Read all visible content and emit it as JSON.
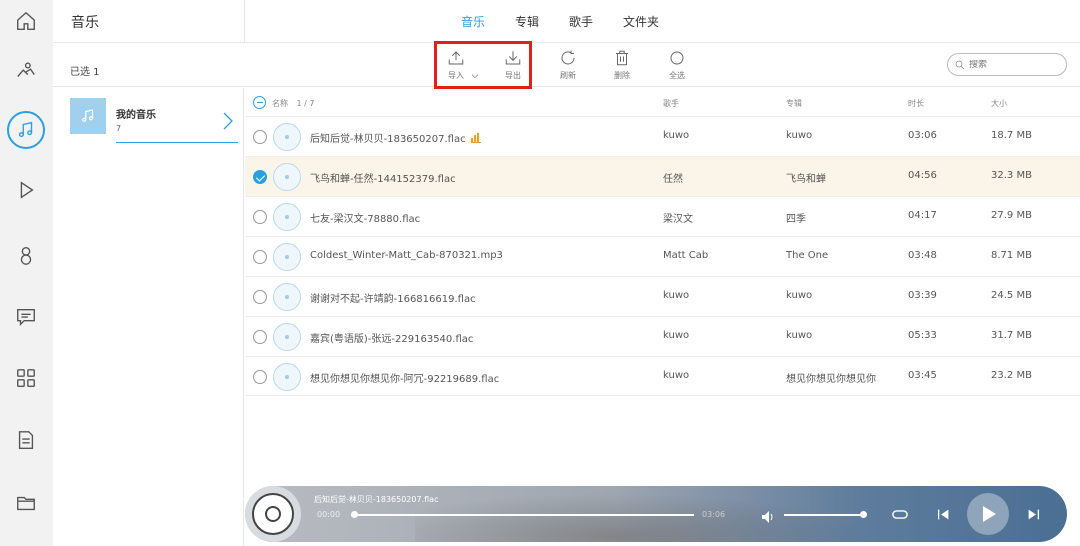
{
  "header": {
    "title": "音乐",
    "tabs": [
      {
        "label": "音乐",
        "active": true
      },
      {
        "label": "专辑",
        "active": false
      },
      {
        "label": "歌手",
        "active": false
      },
      {
        "label": "文件夹",
        "active": false
      }
    ]
  },
  "rail": {
    "items": [
      "home-icon",
      "people-icon",
      "music-note-icon",
      "play-icon",
      "user-icon",
      "message-icon",
      "apps-icon",
      "document-icon",
      "folder-icon"
    ],
    "active": "music-note-icon"
  },
  "toolbar": {
    "selected_text": "已选 1",
    "import_label": "导入",
    "export_label": "导出",
    "refresh_label": "刷新",
    "delete_label": "删除",
    "select_all_label": "全选",
    "search_placeholder": "搜索"
  },
  "playlist": {
    "name": "我的音乐",
    "count": "7"
  },
  "table": {
    "header": {
      "name": "名称",
      "count": "1 / 7",
      "artist": "歌手",
      "album": "专辑",
      "duration": "时长",
      "size": "大小"
    },
    "rows": [
      {
        "name": "后知后觉-林贝贝-183650207.flac",
        "artist": "kuwo",
        "album": "kuwo",
        "duration": "03:06",
        "size": "18.7 MB",
        "selected": false,
        "playing": true
      },
      {
        "name": "飞鸟和蝉-任然-144152379.flac",
        "artist": "任然",
        "album": "飞鸟和蝉",
        "duration": "04:56",
        "size": "32.3 MB",
        "selected": true,
        "playing": false
      },
      {
        "name": "七友-梁汉文-78880.flac",
        "artist": "梁汉文",
        "album": "四季",
        "duration": "04:17",
        "size": "27.9 MB",
        "selected": false,
        "playing": false
      },
      {
        "name": "Coldest_Winter-Matt_Cab-870321.mp3",
        "artist": "Matt Cab",
        "album": "The One",
        "duration": "03:48",
        "size": "8.71 MB",
        "selected": false,
        "playing": false
      },
      {
        "name": "谢谢对不起-许靖韵-166816619.flac",
        "artist": "kuwo",
        "album": "kuwo",
        "duration": "03:39",
        "size": "24.5 MB",
        "selected": false,
        "playing": false
      },
      {
        "name": "嘉宾(粤语版)-张远-229163540.flac",
        "artist": "kuwo",
        "album": "kuwo",
        "duration": "05:33",
        "size": "31.7 MB",
        "selected": false,
        "playing": false
      },
      {
        "name": "想见你想见你想见你-阿冗-92219689.flac",
        "artist": "kuwo",
        "album": "想见你想见你想见你",
        "duration": "03:45",
        "size": "23.2 MB",
        "selected": false,
        "playing": false
      }
    ]
  },
  "player": {
    "title": "后知后觉-林贝贝-183650207.flac",
    "current_time": "00:00",
    "total_time": "03:06",
    "progress": 0,
    "volume": 0.95
  },
  "colors": {
    "accent": "#2aa0e0",
    "highlight_box": "#e0201b",
    "selected_row": "#fbf4e8"
  }
}
